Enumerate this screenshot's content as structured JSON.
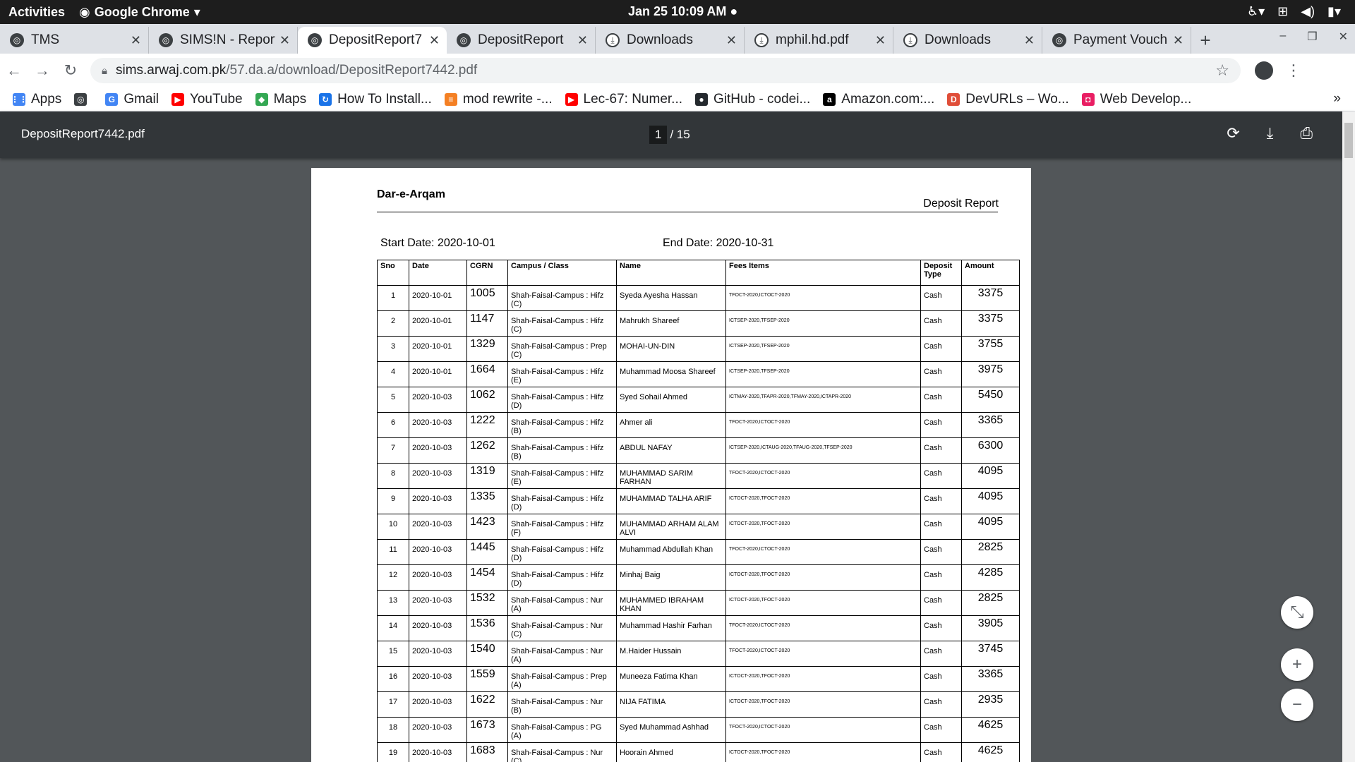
{
  "system": {
    "activities": "Activities",
    "app_name": "Google Chrome",
    "clock": "Jan 25  10:09 AM"
  },
  "tabs": [
    {
      "label": "TMS"
    },
    {
      "label": "SIMS!N - Report"
    },
    {
      "label": "DepositReport7"
    },
    {
      "label": "DepositReport"
    },
    {
      "label": "Downloads"
    },
    {
      "label": "mphil.hd.pdf"
    },
    {
      "label": "Downloads"
    },
    {
      "label": "Payment Vouch"
    }
  ],
  "address": {
    "host": "sims.arwaj.com.pk",
    "path": "/57.da.a/download/DepositReport7442.pdf"
  },
  "bookmarks": [
    {
      "label": "Apps",
      "color": "#4285f4",
      "glyph": "⋮⋮"
    },
    {
      "label": "",
      "color": "#3c4043",
      "glyph": "◎"
    },
    {
      "label": "Gmail",
      "color": "#4285f4",
      "glyph": "G"
    },
    {
      "label": "YouTube",
      "color": "#ff0000",
      "glyph": "▶"
    },
    {
      "label": "Maps",
      "color": "#34a853",
      "glyph": "◆"
    },
    {
      "label": "How To Install...",
      "color": "#1a73e8",
      "glyph": "↻"
    },
    {
      "label": "mod rewrite -...",
      "color": "#f48024",
      "glyph": "≡"
    },
    {
      "label": "Lec-67: Numer...",
      "color": "#ff0000",
      "glyph": "▶"
    },
    {
      "label": "GitHub - codei...",
      "color": "#24292e",
      "glyph": "●"
    },
    {
      "label": "Amazon.com:...",
      "color": "#000000",
      "glyph": "a"
    },
    {
      "label": "DevURLs – Wo...",
      "color": "#e04e39",
      "glyph": "D"
    },
    {
      "label": "Web Develop...",
      "color": "#e91e63",
      "glyph": "◘"
    }
  ],
  "bookmarks_more": "»",
  "pdf": {
    "filename": "DepositReport7442.pdf",
    "page_current": "1",
    "page_total": "/ 15"
  },
  "report": {
    "org": "Dar-e-Arqam",
    "title": "Deposit Report",
    "start_date": "Start Date: 2020-10-01",
    "end_date": "End Date: 2020-10-31",
    "headers": [
      "Sno",
      "Date",
      "CGRN",
      "Campus / Class",
      "Name",
      "Fees Items",
      "Deposit Type",
      "Amount"
    ],
    "rows": [
      [
        "1",
        "2020-10-01",
        "1005",
        "Shah-Faisal-Campus : Hifz (C)",
        "Syeda Ayesha Hassan",
        "TFOCT-2020,ICTOCT-2020",
        "Cash",
        "3375"
      ],
      [
        "2",
        "2020-10-01",
        "1147",
        "Shah-Faisal-Campus : Hifz (C)",
        "Mahrukh Shareef",
        "ICTSEP-2020,TFSEP-2020",
        "Cash",
        "3375"
      ],
      [
        "3",
        "2020-10-01",
        "1329",
        "Shah-Faisal-Campus : Prep (C)",
        "MOHAI-UN-DIN",
        "ICTSEP-2020,TFSEP-2020",
        "Cash",
        "3755"
      ],
      [
        "4",
        "2020-10-01",
        "1664",
        "Shah-Faisal-Campus : Hifz (E)",
        "Muhammad Moosa Shareef",
        "ICTSEP-2020,TFSEP-2020",
        "Cash",
        "3975"
      ],
      [
        "5",
        "2020-10-03",
        "1062",
        "Shah-Faisal-Campus : Hifz (D)",
        "Syed Sohail Ahmed",
        "ICTMAY-2020,TFAPR-2020,TFMAY-2020,ICTAPR-2020",
        "Cash",
        "5450"
      ],
      [
        "6",
        "2020-10-03",
        "1222",
        "Shah-Faisal-Campus : Hifz (B)",
        "Ahmer ali",
        "TFOCT-2020,ICTOCT-2020",
        "Cash",
        "3365"
      ],
      [
        "7",
        "2020-10-03",
        "1262",
        "Shah-Faisal-Campus : Hifz (B)",
        "ABDUL NAFAY",
        "ICTSEP-2020,ICTAUG-2020,TFAUG-2020,TFSEP-2020",
        "Cash",
        "6300"
      ],
      [
        "8",
        "2020-10-03",
        "1319",
        "Shah-Faisal-Campus : Hifz (E)",
        "MUHAMMAD SARIM FARHAN",
        "TFOCT-2020,ICTOCT-2020",
        "Cash",
        "4095"
      ],
      [
        "9",
        "2020-10-03",
        "1335",
        "Shah-Faisal-Campus : Hifz (D)",
        "MUHAMMAD TALHA ARIF",
        "ICTOCT-2020,TFOCT-2020",
        "Cash",
        "4095"
      ],
      [
        "10",
        "2020-10-03",
        "1423",
        "Shah-Faisal-Campus : Hifz (F)",
        "MUHAMMAD ARHAM ALAM ALVI",
        "ICTOCT-2020,TFOCT-2020",
        "Cash",
        "4095"
      ],
      [
        "11",
        "2020-10-03",
        "1445",
        "Shah-Faisal-Campus : Hifz (D)",
        "Muhammad Abdullah Khan",
        "TFOCT-2020,ICTOCT-2020",
        "Cash",
        "2825"
      ],
      [
        "12",
        "2020-10-03",
        "1454",
        "Shah-Faisal-Campus : Hifz (D)",
        "Minhaj Baig",
        "ICTOCT-2020,TFOCT-2020",
        "Cash",
        "4285"
      ],
      [
        "13",
        "2020-10-03",
        "1532",
        "Shah-Faisal-Campus : Nur (A)",
        "MUHAMMED IBRAHAM KHAN",
        "ICTOCT-2020,TFOCT-2020",
        "Cash",
        "2825"
      ],
      [
        "14",
        "2020-10-03",
        "1536",
        "Shah-Faisal-Campus : Nur (C)",
        "Muhammad Hashir Farhan",
        "TFOCT-2020,ICTOCT-2020",
        "Cash",
        "3905"
      ],
      [
        "15",
        "2020-10-03",
        "1540",
        "Shah-Faisal-Campus : Nur (A)",
        "M.Haider Hussain",
        "TFOCT-2020,ICTOCT-2020",
        "Cash",
        "3745"
      ],
      [
        "16",
        "2020-10-03",
        "1559",
        "Shah-Faisal-Campus : Prep (A)",
        "Muneeza Fatima Khan",
        "ICTOCT-2020,TFOCT-2020",
        "Cash",
        "3365"
      ],
      [
        "17",
        "2020-10-03",
        "1622",
        "Shah-Faisal-Campus : Nur (B)",
        "NIJA FATIMA",
        "ICTOCT-2020,TFOCT-2020",
        "Cash",
        "2935"
      ],
      [
        "18",
        "2020-10-03",
        "1673",
        "Shah-Faisal-Campus : PG (A)",
        "Syed Muhammad Ashhad",
        "TFOCT-2020,ICTOCT-2020",
        "Cash",
        "4625"
      ],
      [
        "19",
        "2020-10-03",
        "1683",
        "Shah-Faisal-Campus : Nur (C)",
        "Hoorain Ahmed",
        "ICTOCT-2020,TFOCT-2020",
        "Cash",
        "4625"
      ]
    ]
  }
}
